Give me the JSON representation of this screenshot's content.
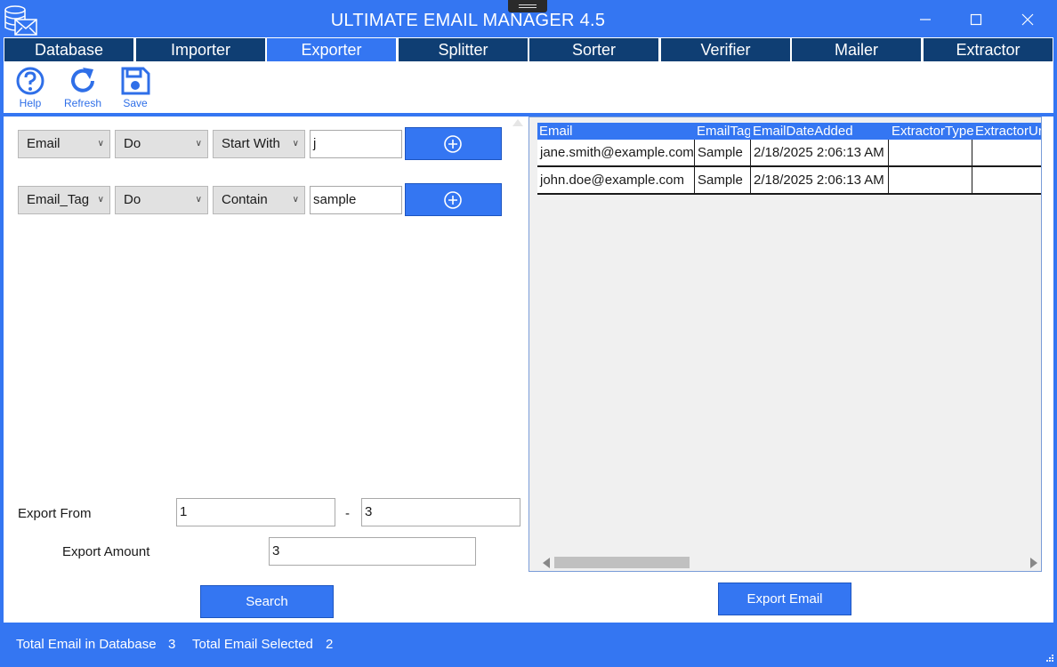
{
  "window": {
    "title": "ULTIMATE EMAIL MANAGER 4.5",
    "accent_color": "#3476f2",
    "tab_color": "#0f3e73"
  },
  "tabs": [
    {
      "label": "Database",
      "active": false
    },
    {
      "label": "Importer",
      "active": false
    },
    {
      "label": "Exporter",
      "active": true
    },
    {
      "label": "Splitter",
      "active": false
    },
    {
      "label": "Sorter",
      "active": false
    },
    {
      "label": "Verifier",
      "active": false
    },
    {
      "label": "Mailer",
      "active": false
    },
    {
      "label": "Extractor",
      "active": false
    }
  ],
  "toolbar": {
    "help_label": "Help",
    "refresh_label": "Refresh",
    "save_label": "Save"
  },
  "filters": [
    {
      "field": "Email",
      "operator": "Do",
      "condition": "Start With",
      "value": "j"
    },
    {
      "field": "Email_Tag",
      "operator": "Do",
      "condition": "Contain",
      "value": "sample"
    }
  ],
  "export": {
    "from_label": "Export From",
    "from_value": "1",
    "separator": "-",
    "to_value": "3",
    "amount_label": "Export Amount",
    "amount_value": "3",
    "search_label": "Search",
    "export_label": "Export Email"
  },
  "grid": {
    "columns": [
      "Email",
      "EmailTag",
      "EmailDateAdded",
      "ExtractorType",
      "ExtractorUrl"
    ],
    "rows": [
      [
        "jane.smith@example.com",
        "Sample",
        "2/18/2025 2:06:13 AM",
        "",
        ""
      ],
      [
        "john.doe@example.com",
        "Sample",
        "2/18/2025 2:06:13 AM",
        "",
        ""
      ]
    ]
  },
  "status": {
    "total_label": "Total Email in Database",
    "total_value": "3",
    "selected_label": "Total Email Selected",
    "selected_value": "2"
  }
}
